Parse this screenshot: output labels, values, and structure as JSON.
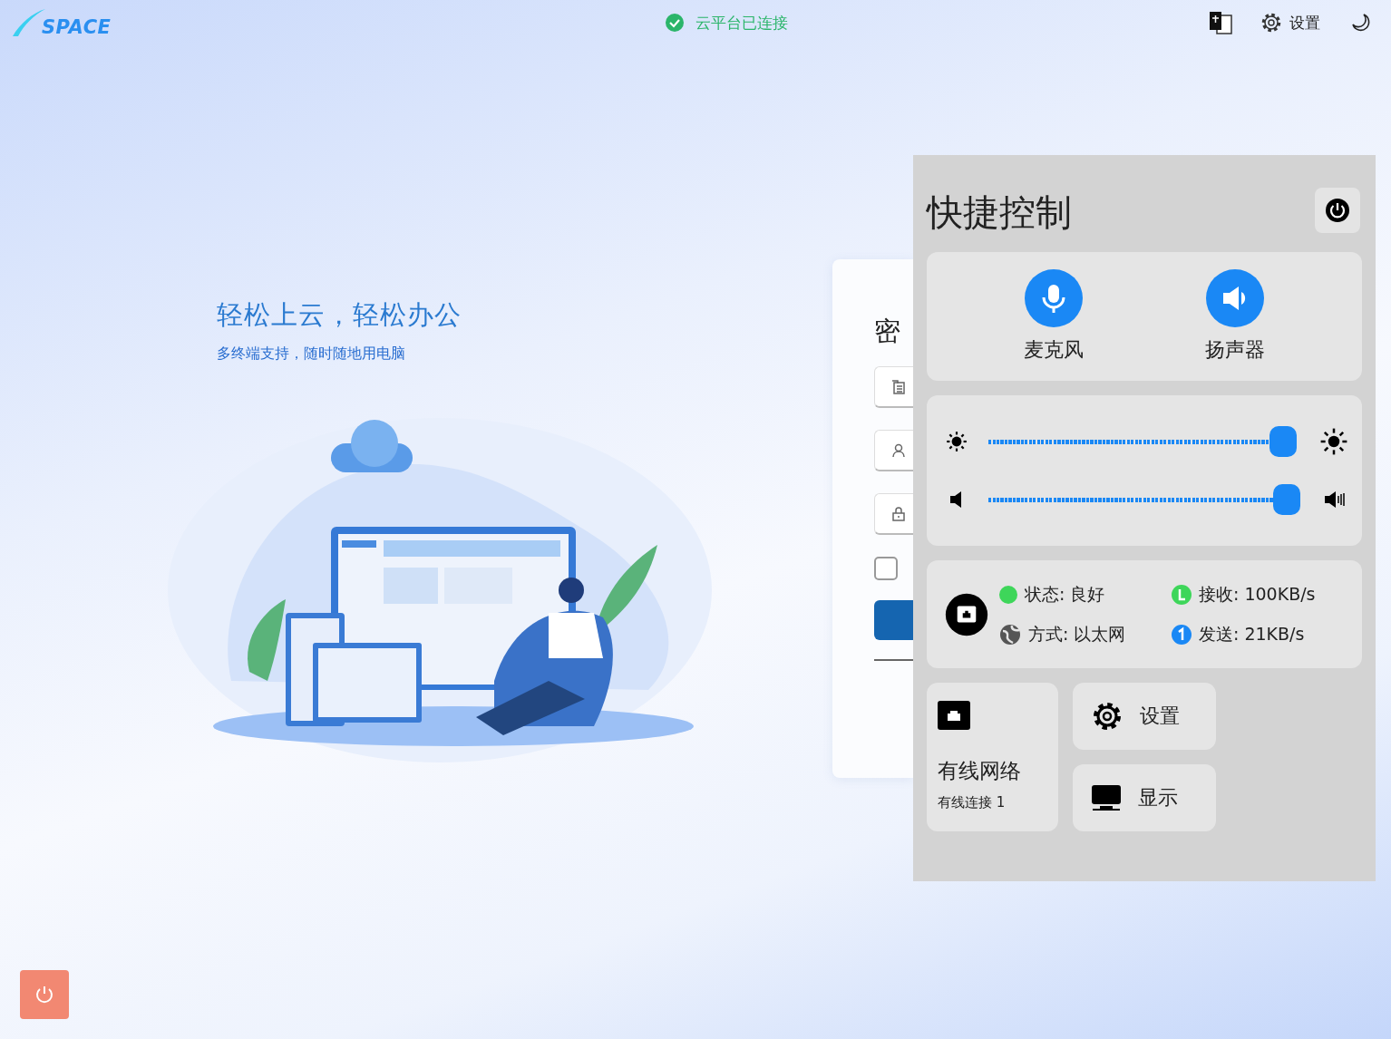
{
  "header": {
    "logo": "SPACE",
    "status": {
      "text": "云平台已连接",
      "connected": true
    },
    "settings_label": "设置"
  },
  "hero": {
    "title": "轻松上云，轻松办公",
    "subtitle": "多终端支持，随时随地用电脑"
  },
  "login_card": {
    "title": "密",
    "fields": [
      {
        "kind": "server"
      },
      {
        "kind": "user"
      },
      {
        "kind": "password"
      }
    ],
    "remember": {
      "checked": false
    }
  },
  "quick_control": {
    "title": "快捷控制",
    "toggles": [
      {
        "kind": "mic",
        "label": "麦克风",
        "on": true
      },
      {
        "kind": "speaker",
        "label": "扬声器",
        "on": true
      }
    ],
    "sliders": [
      {
        "kind": "brightness",
        "level": 1
      },
      {
        "kind": "volume",
        "level": 1
      }
    ],
    "network": {
      "items": [
        {
          "kind": "dot",
          "text": "状态: 良好",
          "color": "#3ed65a"
        },
        {
          "kind": "globe",
          "text": "方式: 以太网"
        },
        {
          "kind": "down",
          "text": "接收: 100KB/s",
          "color": "#3ed65a"
        },
        {
          "kind": "up",
          "text": "发送: 21KB/s",
          "color": "#1a88f5"
        }
      ]
    },
    "wired": {
      "title": "有线网络",
      "subtitle": "有线连接 1"
    },
    "buttons": [
      {
        "kind": "settings",
        "label": "设置"
      },
      {
        "kind": "display",
        "label": "显示"
      }
    ]
  }
}
